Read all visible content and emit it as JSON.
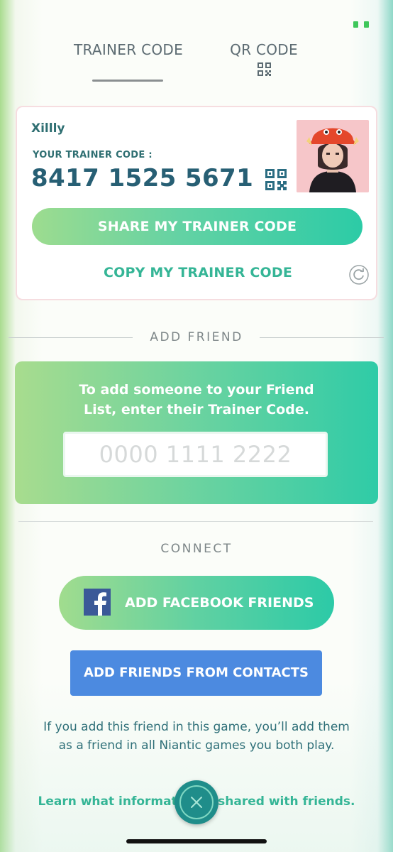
{
  "tabs": [
    {
      "label": "TRAINER CODE",
      "active": true
    },
    {
      "label": "QR CODE",
      "active": false
    }
  ],
  "profile": {
    "username": "Xillly",
    "code_label": "YOUR TRAINER CODE :",
    "trainer_code": "8417 1525 5671",
    "share_label": "SHARE MY TRAINER CODE",
    "copy_label": "COPY MY TRAINER CODE"
  },
  "add_friend": {
    "title": "ADD FRIEND",
    "instructions": "To add someone to your Friend List, enter their Trainer Code.",
    "input_placeholder": "0000 1111 2222",
    "input_value": ""
  },
  "connect": {
    "title": "CONNECT",
    "facebook_label": "ADD FACEBOOK FRIENDS",
    "contacts_label": "ADD FRIENDS FROM CONTACTS"
  },
  "info": {
    "text": "If you add this friend in this game, you’ll add them as a friend in all Niantic games you both play.",
    "learn_more": "Learn what information is shared with friends."
  },
  "colors": {
    "accent_green": "#35b596",
    "code_text": "#275f74",
    "contacts_blue": "#4c8ae0",
    "facebook_blue": "#3b5998"
  },
  "icons": [
    "battery-icon",
    "qr-code-icon",
    "refresh-icon",
    "facebook-icon",
    "close-icon"
  ]
}
